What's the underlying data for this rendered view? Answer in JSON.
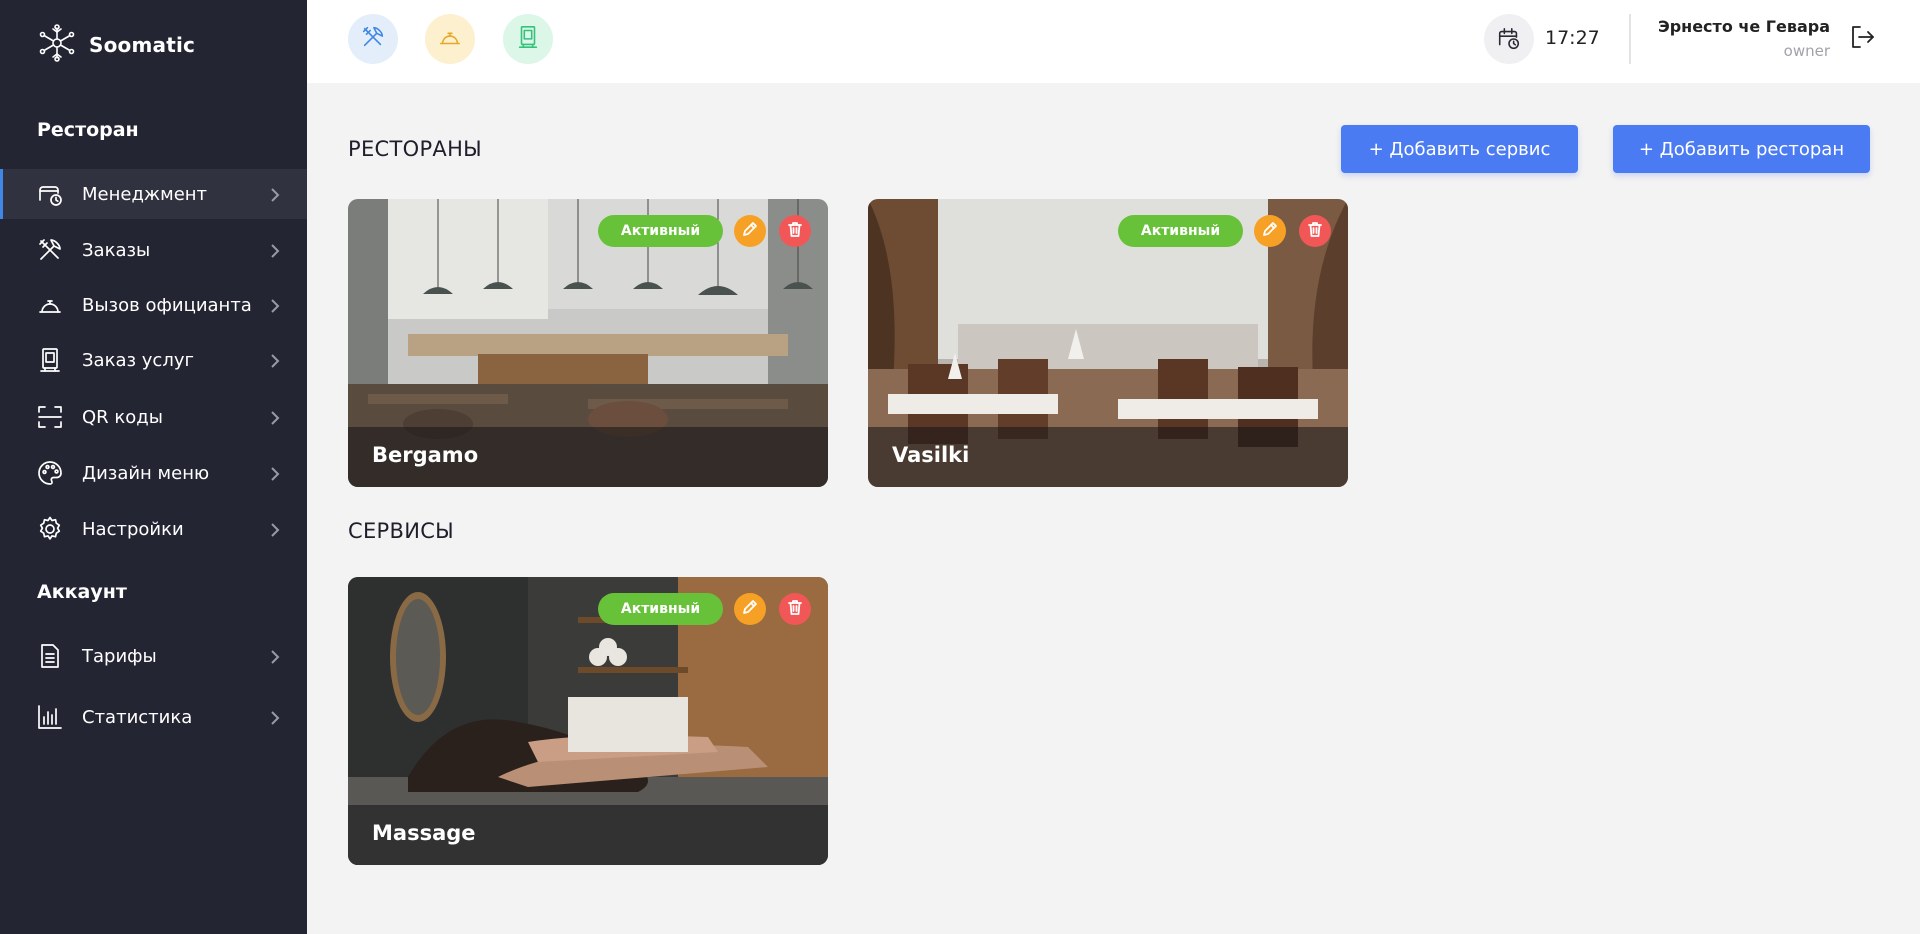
{
  "brand": {
    "name": "Soomatic",
    "icon": "snowflake-logo-icon"
  },
  "sidebar": {
    "sections": [
      {
        "title": "Ресторан"
      },
      {
        "title": "Аккаунт"
      }
    ],
    "items": [
      {
        "label": "Менеджмент",
        "icon": "management-clock-icon",
        "active": true
      },
      {
        "label": "Заказы",
        "icon": "fork-knife-icon"
      },
      {
        "label": "Вызов официанта",
        "icon": "service-bell-icon"
      },
      {
        "label": "Заказ услуг",
        "icon": "service-order-icon"
      },
      {
        "label": "QR коды",
        "icon": "qr-scan-icon"
      },
      {
        "label": "Дизайн меню",
        "icon": "palette-icon"
      },
      {
        "label": "Настройки",
        "icon": "gear-icon"
      },
      {
        "label": "Тарифы",
        "icon": "document-icon"
      },
      {
        "label": "Статистика",
        "icon": "bar-chart-icon"
      }
    ]
  },
  "header": {
    "quick_actions": [
      {
        "icon": "fork-knife-icon",
        "bg": "#e3eefa",
        "color": "#3f86e6"
      },
      {
        "icon": "service-bell-icon",
        "bg": "#fdf0cf",
        "color": "#e7a825"
      },
      {
        "icon": "service-order-icon",
        "bg": "#dcf6e8",
        "color": "#35c27a"
      }
    ],
    "time": "17:27",
    "user": {
      "name": "Эрнесто че Гевара",
      "role": "owner"
    }
  },
  "main": {
    "restaurants_title": "РЕСТОРАНЫ",
    "services_title": "СЕРВИСЫ",
    "add_service_label": "+ Добавить сервис",
    "add_restaurant_label": "+ Добавить ресторан",
    "restaurants": [
      {
        "name": "Bergamo",
        "status": "Активный"
      },
      {
        "name": "Vasilki",
        "status": "Активный"
      }
    ],
    "services": [
      {
        "name": "Massage",
        "status": "Активный"
      }
    ]
  },
  "colors": {
    "sidebar_bg": "#242533",
    "accent": "#4a7bf3",
    "active_badge": "#67c23a",
    "edit": "#f7a026",
    "delete": "#f25757"
  }
}
